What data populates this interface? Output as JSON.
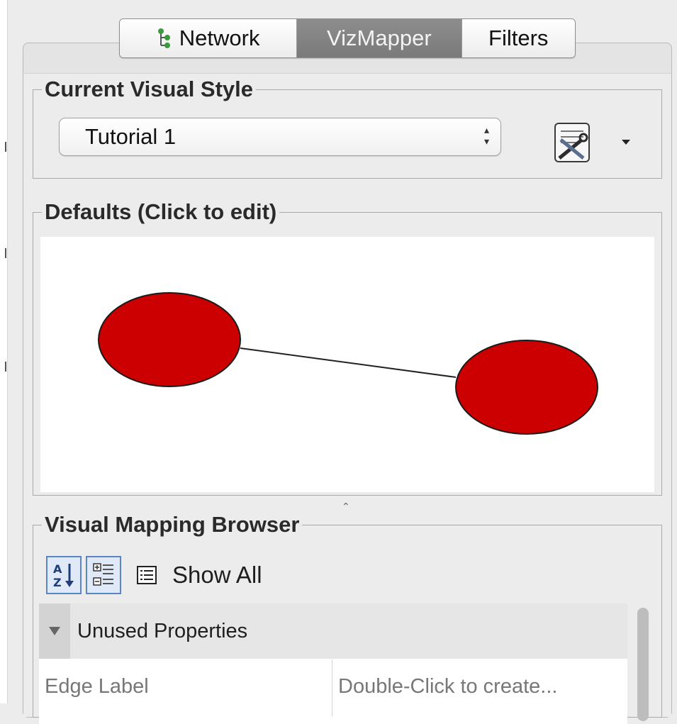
{
  "tabs": [
    {
      "label": "Network",
      "icon": "network-tree-icon",
      "active": false
    },
    {
      "label": "VizMapper",
      "active": true
    },
    {
      "label": "Filters",
      "active": false
    }
  ],
  "current_visual_style": {
    "title": "Current Visual Style",
    "selected": "Tutorial 1"
  },
  "defaults": {
    "title": "Defaults (Click to edit)",
    "node_fill": "#cc0000",
    "node_border": "#1a1a1a",
    "edge_color": "#222222"
  },
  "browser": {
    "title": "Visual Mapping Browser",
    "show_all_label": "Show All",
    "category": "Unused Properties",
    "rows": [
      {
        "name": "Edge Label",
        "value": "Double-Click to create..."
      }
    ]
  },
  "colors": {
    "active_tab": "#808080",
    "toolbar_accent": "#5b86c5"
  }
}
